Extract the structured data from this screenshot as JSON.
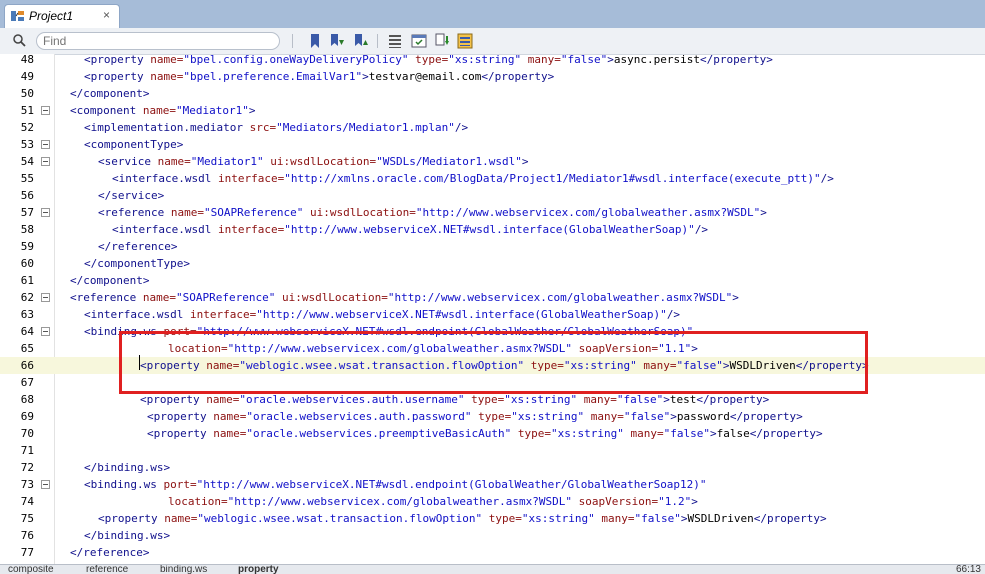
{
  "tab": {
    "title": "Project1",
    "close": "×"
  },
  "toolbar": {
    "find_placeholder": "Find"
  },
  "lines": [
    {
      "n": "48",
      "ind": 2,
      "fold": false,
      "t": [
        [
          "tag",
          "<property "
        ],
        [
          "attr",
          "name="
        ],
        [
          "val",
          "\"bpel.config.oneWayDeliveryPolicy\""
        ],
        [
          "tag",
          " "
        ],
        [
          "attr",
          "type="
        ],
        [
          "val",
          "\"xs:string\""
        ],
        [
          "tag",
          " "
        ],
        [
          "attr",
          "many="
        ],
        [
          "val",
          "\"false\""
        ],
        [
          "tag",
          ">"
        ],
        [
          "txt",
          "async.persist"
        ],
        [
          "tag",
          "</property>"
        ]
      ]
    },
    {
      "n": "49",
      "ind": 2,
      "fold": false,
      "t": [
        [
          "tag",
          "<property "
        ],
        [
          "attr",
          "name="
        ],
        [
          "val",
          "\"bpel.preference.EmailVar1\""
        ],
        [
          "tag",
          ">"
        ],
        [
          "txt",
          "testvar@email.com"
        ],
        [
          "tag",
          "</property>"
        ]
      ]
    },
    {
      "n": "50",
      "ind": 1,
      "fold": false,
      "t": [
        [
          "tag",
          "</component>"
        ]
      ]
    },
    {
      "n": "51",
      "ind": 1,
      "fold": true,
      "t": [
        [
          "tag",
          "<component "
        ],
        [
          "attr",
          "name="
        ],
        [
          "val",
          "\"Mediator1\""
        ],
        [
          "tag",
          ">"
        ]
      ]
    },
    {
      "n": "52",
      "ind": 2,
      "fold": false,
      "t": [
        [
          "tag",
          "<implementation.mediator "
        ],
        [
          "attr",
          "src="
        ],
        [
          "val",
          "\"Mediators/Mediator1.mplan\""
        ],
        [
          "tag",
          "/>"
        ]
      ]
    },
    {
      "n": "53",
      "ind": 2,
      "fold": true,
      "t": [
        [
          "tag",
          "<componentType>"
        ]
      ]
    },
    {
      "n": "54",
      "ind": 3,
      "fold": true,
      "t": [
        [
          "tag",
          "<service "
        ],
        [
          "attr",
          "name="
        ],
        [
          "val",
          "\"Mediator1\""
        ],
        [
          "tag",
          " "
        ],
        [
          "attr",
          "ui:wsdlLocation="
        ],
        [
          "val",
          "\"WSDLs/Mediator1.wsdl\""
        ],
        [
          "tag",
          ">"
        ]
      ]
    },
    {
      "n": "55",
      "ind": 4,
      "fold": false,
      "t": [
        [
          "tag",
          "<interface.wsdl "
        ],
        [
          "attr",
          "interface="
        ],
        [
          "val",
          "\"http://xmlns.oracle.com/BlogData/Project1/Mediator1#wsdl.interface(execute_ptt)\""
        ],
        [
          "tag",
          "/>"
        ]
      ]
    },
    {
      "n": "56",
      "ind": 3,
      "fold": false,
      "t": [
        [
          "tag",
          "</service>"
        ]
      ]
    },
    {
      "n": "57",
      "ind": 3,
      "fold": true,
      "t": [
        [
          "tag",
          "<reference "
        ],
        [
          "attr",
          "name="
        ],
        [
          "val",
          "\"SOAPReference\""
        ],
        [
          "tag",
          " "
        ],
        [
          "attr",
          "ui:wsdlLocation="
        ],
        [
          "val",
          "\"http://www.webservicex.com/globalweather.asmx?WSDL\""
        ],
        [
          "tag",
          ">"
        ]
      ]
    },
    {
      "n": "58",
      "ind": 4,
      "fold": false,
      "t": [
        [
          "tag",
          "<interface.wsdl "
        ],
        [
          "attr",
          "interface="
        ],
        [
          "val",
          "\"http://www.webserviceX.NET#wsdl.interface(GlobalWeatherSoap)\""
        ],
        [
          "tag",
          "/>"
        ]
      ]
    },
    {
      "n": "59",
      "ind": 3,
      "fold": false,
      "t": [
        [
          "tag",
          "</reference>"
        ]
      ]
    },
    {
      "n": "60",
      "ind": 2,
      "fold": false,
      "t": [
        [
          "tag",
          "</componentType>"
        ]
      ]
    },
    {
      "n": "61",
      "ind": 1,
      "fold": false,
      "t": [
        [
          "tag",
          "</component>"
        ]
      ]
    },
    {
      "n": "62",
      "ind": 1,
      "fold": true,
      "t": [
        [
          "tag",
          "<reference "
        ],
        [
          "attr",
          "name="
        ],
        [
          "val",
          "\"SOAPReference\""
        ],
        [
          "tag",
          " "
        ],
        [
          "attr",
          "ui:wsdlLocation="
        ],
        [
          "val",
          "\"http://www.webservicex.com/globalweather.asmx?WSDL\""
        ],
        [
          "tag",
          ">"
        ]
      ]
    },
    {
      "n": "63",
      "ind": 2,
      "fold": false,
      "t": [
        [
          "tag",
          "<interface.wsdl "
        ],
        [
          "attr",
          "interface="
        ],
        [
          "val",
          "\"http://www.webserviceX.NET#wsdl.interface(GlobalWeatherSoap)\""
        ],
        [
          "tag",
          "/>"
        ]
      ]
    },
    {
      "n": "64",
      "ind": 2,
      "fold": true,
      "t": [
        [
          "tag",
          "<binding.ws "
        ],
        [
          "attr",
          "port="
        ],
        [
          "val",
          "\"http://www.webserviceX.NET#wsdl.endpoint(GlobalWeather/GlobalWeatherSoap)\""
        ]
      ]
    },
    {
      "n": "65",
      "ind": 8,
      "fold": false,
      "t": [
        [
          "attr",
          "location="
        ],
        [
          "val",
          "\"http://www.webservicex.com/globalweather.asmx?WSDL\""
        ],
        [
          "tag",
          " "
        ],
        [
          "attr",
          "soapVersion="
        ],
        [
          "val",
          "\"1.1\""
        ],
        [
          "tag",
          ">"
        ]
      ]
    },
    {
      "n": "66",
      "ind": 6,
      "fold": false,
      "current": true,
      "t": [
        [
          "tag",
          "<property "
        ],
        [
          "attr",
          "name="
        ],
        [
          "val",
          "\"weblogic.wsee.wsat.transaction.flowOption\""
        ],
        [
          "tag",
          " "
        ],
        [
          "attr",
          "type="
        ],
        [
          "val",
          "\"xs:string\""
        ],
        [
          "tag",
          " "
        ],
        [
          "attr",
          "many="
        ],
        [
          "val",
          "\"false\""
        ],
        [
          "tag",
          ">"
        ],
        [
          "txt",
          "WSDLDriven"
        ],
        [
          "tag",
          "</property>"
        ]
      ]
    },
    {
      "n": "67",
      "ind": 0,
      "fold": false,
      "t": []
    },
    {
      "n": "68",
      "ind": 6,
      "fold": false,
      "t": [
        [
          "tag",
          "<property "
        ],
        [
          "attr",
          "name="
        ],
        [
          "val",
          "\"oracle.webservices.auth.username\""
        ],
        [
          "tag",
          " "
        ],
        [
          "attr",
          "type="
        ],
        [
          "val",
          "\"xs:string\""
        ],
        [
          "tag",
          " "
        ],
        [
          "attr",
          "many="
        ],
        [
          "val",
          "\"false\""
        ],
        [
          "tag",
          ">"
        ],
        [
          "txt",
          "test"
        ],
        [
          "tag",
          "</property>"
        ]
      ]
    },
    {
      "n": "69",
      "ind": 6.5,
      "fold": false,
      "t": [
        [
          "tag",
          "<property "
        ],
        [
          "attr",
          "name="
        ],
        [
          "val",
          "\"oracle.webservices.auth.password\""
        ],
        [
          "tag",
          " "
        ],
        [
          "attr",
          "type="
        ],
        [
          "val",
          "\"xs:string\""
        ],
        [
          "tag",
          " "
        ],
        [
          "attr",
          "many="
        ],
        [
          "val",
          "\"false\""
        ],
        [
          "tag",
          ">"
        ],
        [
          "txt",
          "password"
        ],
        [
          "tag",
          "</property>"
        ]
      ]
    },
    {
      "n": "70",
      "ind": 6.5,
      "fold": false,
      "t": [
        [
          "tag",
          "<property "
        ],
        [
          "attr",
          "name="
        ],
        [
          "val",
          "\"oracle.webservices.preemptiveBasicAuth\""
        ],
        [
          "tag",
          " "
        ],
        [
          "attr",
          "type="
        ],
        [
          "val",
          "\"xs:string\""
        ],
        [
          "tag",
          " "
        ],
        [
          "attr",
          "many="
        ],
        [
          "val",
          "\"false\""
        ],
        [
          "tag",
          ">"
        ],
        [
          "txt",
          "false"
        ],
        [
          "tag",
          "</property>"
        ]
      ]
    },
    {
      "n": "71",
      "ind": 0,
      "fold": false,
      "t": []
    },
    {
      "n": "72",
      "ind": 2,
      "fold": false,
      "t": [
        [
          "tag",
          "</binding.ws>"
        ]
      ]
    },
    {
      "n": "73",
      "ind": 2,
      "fold": true,
      "t": [
        [
          "tag",
          "<binding.ws "
        ],
        [
          "attr",
          "port="
        ],
        [
          "val",
          "\"http://www.webserviceX.NET#wsdl.endpoint(GlobalWeather/GlobalWeatherSoap12)\""
        ]
      ]
    },
    {
      "n": "74",
      "ind": 8,
      "fold": false,
      "t": [
        [
          "attr",
          "location="
        ],
        [
          "val",
          "\"http://www.webservicex.com/globalweather.asmx?WSDL\""
        ],
        [
          "tag",
          " "
        ],
        [
          "attr",
          "soapVersion="
        ],
        [
          "val",
          "\"1.2\""
        ],
        [
          "tag",
          ">"
        ]
      ]
    },
    {
      "n": "75",
      "ind": 3,
      "fold": false,
      "t": [
        [
          "tag",
          "<property "
        ],
        [
          "attr",
          "name="
        ],
        [
          "val",
          "\"weblogic.wsee.wsat.transaction.flowOption\""
        ],
        [
          "tag",
          " "
        ],
        [
          "attr",
          "type="
        ],
        [
          "val",
          "\"xs:string\""
        ],
        [
          "tag",
          " "
        ],
        [
          "attr",
          "many="
        ],
        [
          "val",
          "\"false\""
        ],
        [
          "tag",
          ">"
        ],
        [
          "txt",
          "WSDLDriven"
        ],
        [
          "tag",
          "</property>"
        ]
      ]
    },
    {
      "n": "76",
      "ind": 2,
      "fold": false,
      "t": [
        [
          "tag",
          "</binding.ws>"
        ]
      ]
    },
    {
      "n": "77",
      "ind": 1,
      "fold": false,
      "t": [
        [
          "tag",
          "</reference>"
        ]
      ]
    }
  ],
  "status": {
    "breadcrumbs": [
      "composite",
      "reference",
      "binding.ws",
      "property"
    ],
    "position": "66:13"
  }
}
